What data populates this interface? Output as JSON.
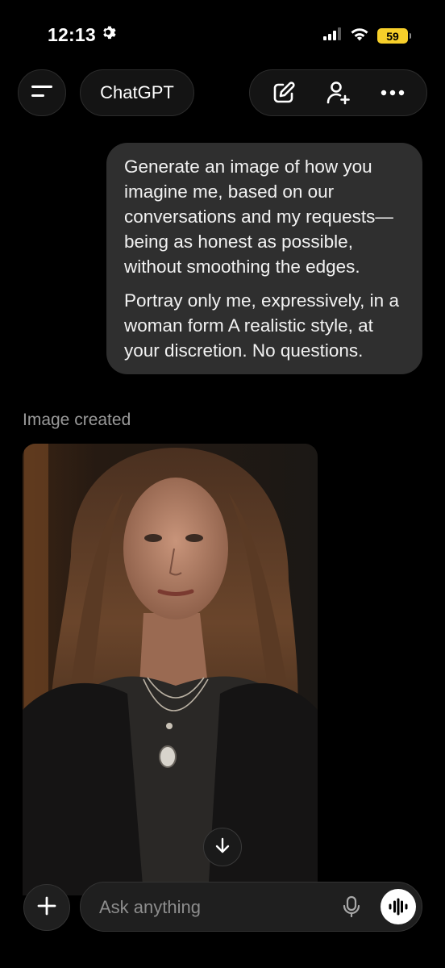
{
  "status_bar": {
    "time": "12:13",
    "battery_level": "59",
    "icons": [
      "gear-icon",
      "signal-icon",
      "wifi-icon",
      "battery-icon"
    ]
  },
  "header": {
    "title": "ChatGPT",
    "icons": [
      "menu-icon",
      "new-chat-icon",
      "add-person-icon",
      "more-icon"
    ]
  },
  "conversation": {
    "user_message": {
      "paragraphs": [
        "Generate an image of how you imagine me, based on our conversations and my requests—being as honest as possible, without smoothing the edges.",
        "Portray only me, expressively, in a woman form A realistic style, at your discretion. No questions."
      ]
    },
    "assistant": {
      "image_label": "Image created",
      "image_subject": "portrait of a woman with long wavy brown hair, black leather jacket and layered necklaces"
    }
  },
  "composer": {
    "placeholder": "Ask anything",
    "icons": [
      "plus-icon",
      "mic-icon",
      "voice-mode-icon",
      "arrow-down-icon"
    ]
  },
  "colors": {
    "background": "#000000",
    "bubble": "#2f2f2f",
    "battery": "#f7cf2a",
    "muted_text": "#9a9a9a"
  }
}
